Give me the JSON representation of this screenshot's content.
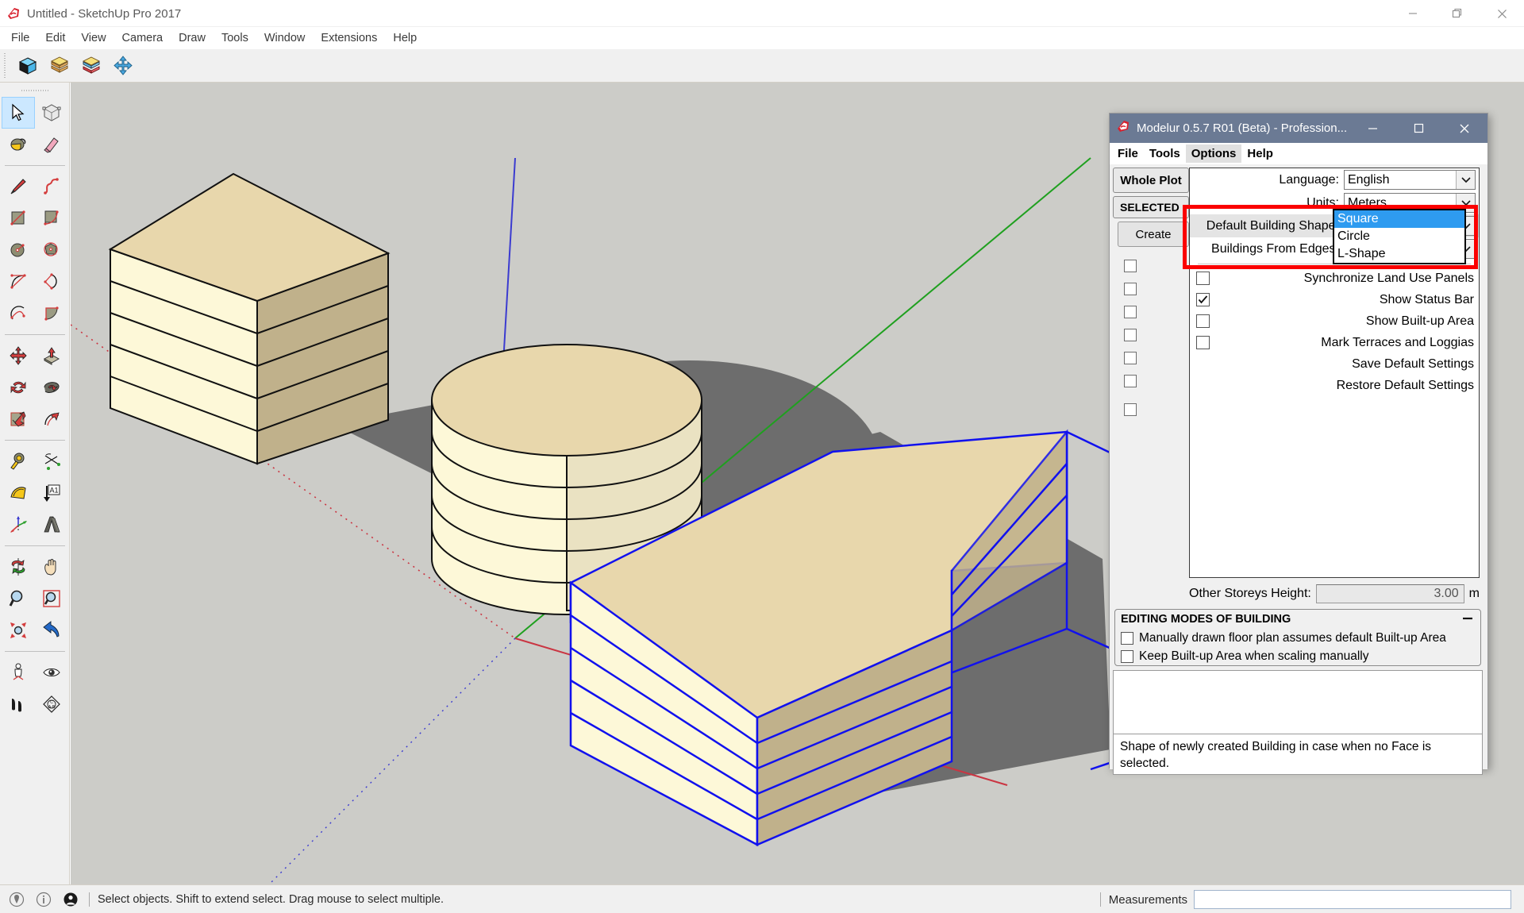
{
  "window": {
    "title": "Untitled - SketchUp Pro 2017",
    "app_icon": "sketchup-logo-icon",
    "controls": {
      "minimize": "minimize-icon",
      "maximize": "maximize-icon",
      "close": "close-icon"
    }
  },
  "menubar": {
    "items": [
      "File",
      "Edit",
      "View",
      "Camera",
      "Draw",
      "Tools",
      "Window",
      "Extensions",
      "Help"
    ]
  },
  "toolbar_top": {
    "buttons": [
      {
        "name": "modelur-model-icon"
      },
      {
        "name": "modelur-building-icon"
      },
      {
        "name": "modelur-land-use-icon"
      },
      {
        "name": "modelur-move-icon"
      }
    ]
  },
  "toolbar_left": {
    "groups": [
      [
        {
          "name": "select-tool-icon",
          "selected": true
        },
        {
          "name": "make-component-icon",
          "selected": false
        }
      ],
      [
        {
          "name": "paint-bucket-icon",
          "selected": false
        },
        {
          "name": "eraser-icon",
          "selected": false
        }
      ],
      [
        {
          "name": "line-tool-icon",
          "selected": false
        },
        {
          "name": "freehand-tool-icon",
          "selected": false
        },
        {
          "name": "rectangle-tool-icon",
          "selected": false
        },
        {
          "name": "rotated-rectangle-icon",
          "selected": false
        },
        {
          "name": "circle-tool-icon",
          "selected": false
        },
        {
          "name": "polygon-tool-icon",
          "selected": false
        },
        {
          "name": "arc-tool-icon",
          "selected": false
        },
        {
          "name": "two-point-arc-icon",
          "selected": false
        },
        {
          "name": "three-point-arc-icon",
          "selected": false
        },
        {
          "name": "pie-tool-icon",
          "selected": false
        }
      ],
      [
        {
          "name": "move-tool-icon",
          "selected": false
        },
        {
          "name": "push-pull-tool-icon",
          "selected": false
        },
        {
          "name": "rotate-tool-icon",
          "selected": false
        },
        {
          "name": "follow-me-tool-icon",
          "selected": false
        },
        {
          "name": "scale-tool-icon",
          "selected": false
        },
        {
          "name": "offset-tool-icon",
          "selected": false
        }
      ],
      [
        {
          "name": "tape-measure-icon",
          "selected": false
        },
        {
          "name": "protractor-icon",
          "selected": false
        },
        {
          "name": "dimension-tool-icon",
          "selected": false
        },
        {
          "name": "text-tool-icon",
          "selected": false
        },
        {
          "name": "axes-tool-icon",
          "selected": false
        },
        {
          "name": "3d-text-tool-icon",
          "selected": false
        }
      ],
      [
        {
          "name": "orbit-tool-icon",
          "selected": false
        },
        {
          "name": "pan-tool-icon",
          "selected": false
        },
        {
          "name": "zoom-tool-icon",
          "selected": false
        },
        {
          "name": "zoom-window-icon",
          "selected": false
        },
        {
          "name": "zoom-extents-icon",
          "selected": false
        },
        {
          "name": "previous-view-icon",
          "selected": false
        },
        {
          "name": "position-camera-icon",
          "selected": false
        },
        {
          "name": "look-around-icon",
          "selected": false
        },
        {
          "name": "walk-tool-icon",
          "selected": false
        },
        {
          "name": "section-plane-icon",
          "selected": false
        }
      ]
    ]
  },
  "statusbar": {
    "icons": [
      "location-icon",
      "info-icon",
      "person-icon"
    ],
    "message": "Select objects. Shift to extend select. Drag mouse to select multiple.",
    "measurements_label": "Measurements",
    "measurements_value": ""
  },
  "dialog": {
    "title": "Modelur 0.5.7 R01 (Beta) - Profession...",
    "icon": "modelur-logo-icon",
    "controls": {
      "minimize": "minimize-icon",
      "maximize": "maximize-icon",
      "close": "close-icon"
    },
    "menu": [
      "File",
      "Tools",
      "Options",
      "Help"
    ],
    "active_menu": "Options",
    "tabs": {
      "whole_plot": "Whole Plot",
      "selected": "SELECTED"
    },
    "create_button": "Create",
    "options_panel": {
      "language_label": "Language:",
      "language_value": "English",
      "units_label": "Units:",
      "units_value": "Meters",
      "default_building_shape_label": "Default Building Shape:",
      "default_building_shape_value": "Square",
      "buildings_from_edges_label": "Buildings From Edges:",
      "checkboxes": [
        {
          "label": "Synchronize Land Use Panels",
          "checked": false
        },
        {
          "label": "Show Status Bar",
          "checked": true
        },
        {
          "label": "Show Built-up Area",
          "checked": false
        },
        {
          "label": "Mark Terraces and Loggias",
          "checked": false
        }
      ],
      "actions": [
        "Save Default Settings",
        "Restore Default Settings"
      ]
    },
    "dropdown": {
      "open": true,
      "options": [
        "Square",
        "Circle",
        "L-Shape"
      ],
      "selected_index": 0
    },
    "other_storeys": {
      "label": "Other Storeys Height:",
      "value": "3.00",
      "unit": "m"
    },
    "editing_modes": {
      "title": "EDITING MODES OF BUILDING",
      "collapse_icon": "minus-icon",
      "items": [
        {
          "label": "Manually drawn floor plan assumes default Built-up Area",
          "checked": false
        },
        {
          "label": "Keep Built-up Area when scaling manually",
          "checked": false
        }
      ]
    },
    "help_text": "Shape of newly created Building in case when no Face is selected."
  },
  "annotation": {
    "type": "red-rectangle-highlight",
    "color": "#fb0000"
  },
  "viewport": {
    "background_color": "#ccccc8",
    "models": [
      {
        "name": "square-building",
        "storeys": 5,
        "shape": "square",
        "selected": false
      },
      {
        "name": "circle-building",
        "storeys": 5,
        "shape": "circle",
        "selected": false
      },
      {
        "name": "l-shape-building",
        "storeys": 5,
        "shape": "l-shape",
        "selected": true
      }
    ],
    "axes": {
      "red": "#ca3542",
      "green": "#1fa01f",
      "blue": "#3b3bd0"
    },
    "selection_color": "#1111ee",
    "face_colors": {
      "top": "#e8d7ac",
      "front": "#fdf8d8",
      "side": "#c0b18b"
    }
  }
}
